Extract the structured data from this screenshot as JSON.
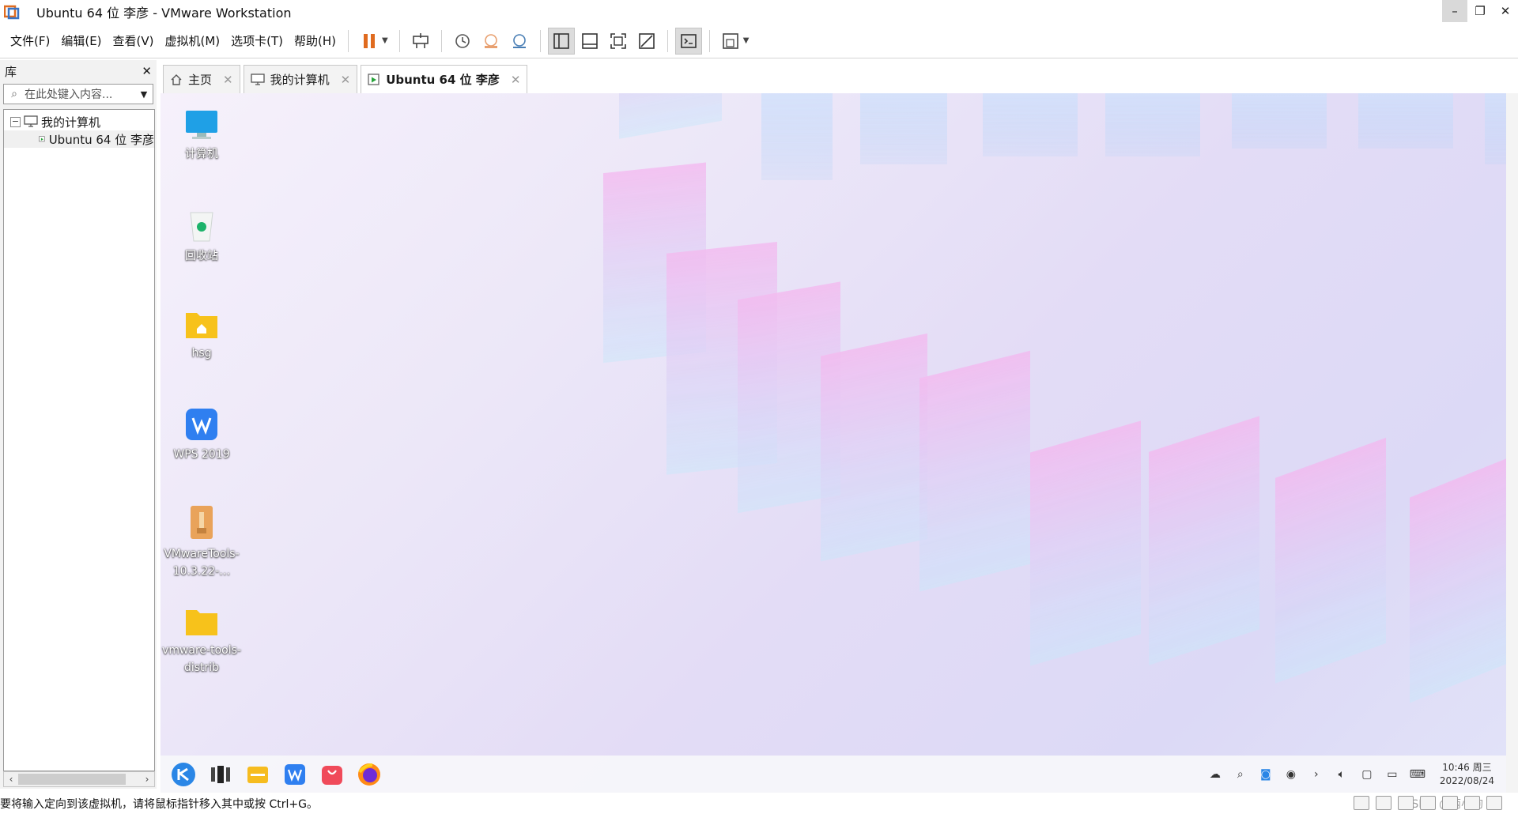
{
  "window": {
    "title": "Ubuntu 64 位 李彦 - VMware Workstation",
    "buttons": {
      "minimize": "–",
      "restore": "❐",
      "close": "✕"
    }
  },
  "menu": [
    "文件(F)",
    "编辑(E)",
    "查看(V)",
    "虚拟机(M)",
    "选项卡(T)",
    "帮助(H)"
  ],
  "toolbar": {
    "icons": [
      "pause-icon",
      "send-ctrl-alt-del-icon",
      "snapshot-icon",
      "revert-snapshot-icon",
      "snapshot-manager-icon",
      "library-view-icon",
      "thumbnail-view-icon",
      "fullscreen-icon",
      "unity-icon",
      "console-icon",
      "stretch-icon"
    ]
  },
  "library": {
    "title": "库",
    "close": "✕",
    "search_placeholder": "在此处键入内容...",
    "tree": {
      "root": "我的计算机",
      "children": [
        "Ubuntu 64 位 李彦"
      ]
    }
  },
  "tabs": [
    {
      "label": "主页",
      "icon": "home-icon"
    },
    {
      "label": "我的计算机",
      "icon": "computer-icon"
    },
    {
      "label": "Ubuntu 64 位 李彦",
      "icon": "vm-icon",
      "active": true
    }
  ],
  "desktop": {
    "icons": [
      {
        "label": "计算机",
        "icon": "computer-icon"
      },
      {
        "label": "回收站",
        "icon": "recycle-bin-icon"
      },
      {
        "label": "hsg",
        "icon": "home-folder-icon"
      },
      {
        "label": "WPS 2019",
        "icon": "wps-icon"
      },
      {
        "label": "VMwareTools-10.3.22-…",
        "icon": "archive-icon"
      },
      {
        "label": "vmware-tools-distrib",
        "icon": "folder-icon"
      }
    ]
  },
  "guest_taskbar": {
    "apps": [
      "launcher-icon",
      "multitask-icon",
      "file-manager-icon",
      "wps-icon",
      "app-store-icon",
      "firefox-icon"
    ],
    "tray": [
      "cloud-icon",
      "search-icon",
      "network-icon",
      "update-icon",
      "expand-icon",
      "volume-icon",
      "notification-icon",
      "message-icon",
      "input-method-icon"
    ],
    "clock_time": "10:46 周三",
    "clock_date": "2022/08/24"
  },
  "statusbar": {
    "hint": "要将输入定向到该虚拟机，请将鼠标指针移入其中或按 Ctrl+G。",
    "watermark": "CSDN @两小狗"
  },
  "colors": {
    "accent": "#e06b1f",
    "selection": "#0078d7"
  }
}
